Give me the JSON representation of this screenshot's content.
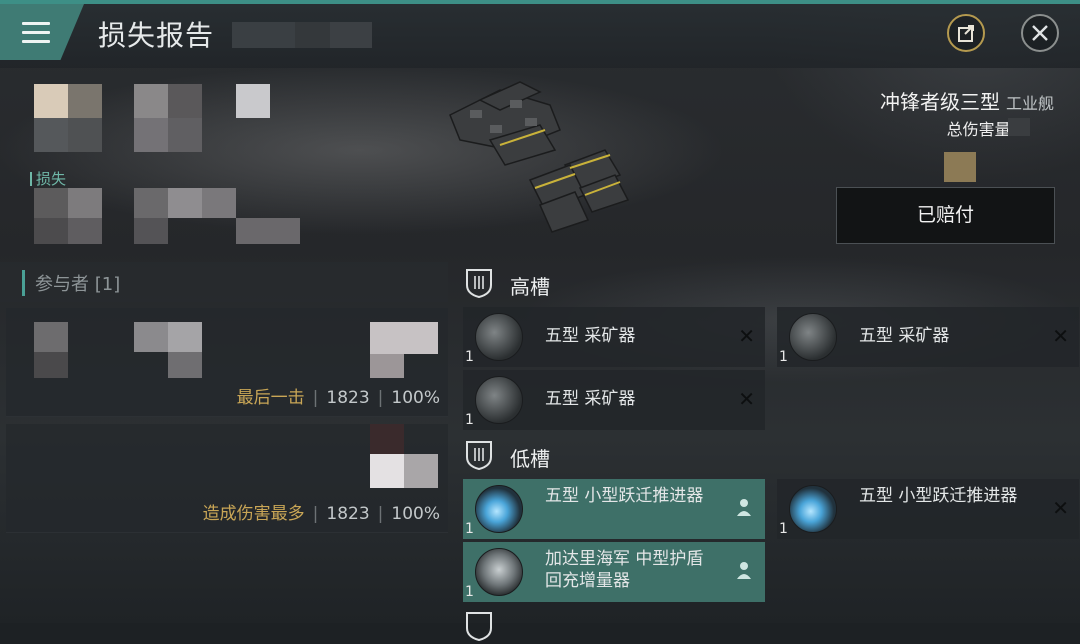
{
  "header": {
    "title": "损失报告",
    "share_icon": "share-icon",
    "close_icon": "close-icon"
  },
  "victim": {
    "loss_label": "损失"
  },
  "ship": {
    "name": "冲锋者级三型",
    "class": "工业舰",
    "damage_label": "总伤害量:",
    "status": "已赔付"
  },
  "participants": {
    "title": "参与者 [1]",
    "rows": [
      {
        "label": "最后一击",
        "value": "1823",
        "percent": "100%"
      },
      {
        "label": "造成伤害最多",
        "value": "1823",
        "percent": "100%"
      }
    ]
  },
  "slots": {
    "high": {
      "title": "高槽",
      "modules": [
        {
          "name": "五型 采矿器",
          "qty": "1"
        },
        {
          "name": "五型 采矿器",
          "qty": "1"
        },
        {
          "name": "五型 采矿器",
          "qty": "1"
        }
      ]
    },
    "low": {
      "title": "低槽",
      "modules": [
        {
          "name": "五型 小型跃迁推进器",
          "qty": "1"
        },
        {
          "name": "五型 小型跃迁推进器",
          "qty": "1"
        },
        {
          "name": "加达里海军 中型护盾回充增量器",
          "qty": "1"
        }
      ]
    }
  },
  "colors": {
    "accent": "#3f7b74",
    "active_module": "#3e7068",
    "gold_text": "#c9a656",
    "loss_text": "#6fb8a8"
  }
}
